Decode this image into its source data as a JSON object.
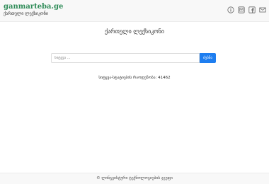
{
  "header": {
    "logo_text": "ganmarteba.ge",
    "logo_subtitle": "ქართული ლექსიკონი",
    "icons": [
      "info-icon",
      "mail-square-icon",
      "facebook-icon",
      "envelope-icon"
    ]
  },
  "main": {
    "title": "ქართული ლექსიკონი",
    "search": {
      "placeholder": "სიტყვა ...",
      "button_label": "ძებნა"
    },
    "stats_text": "სიტყვა-სტატიების რაოდენობა: 41462"
  },
  "footer": {
    "text": "© ლინგვისტური ტექნოლოგიების ჯგუფი"
  },
  "colors": {
    "logo_green": "#2e8b57",
    "accent_blue": "#1e7ef0",
    "header_bg": "#f8f8f8"
  }
}
